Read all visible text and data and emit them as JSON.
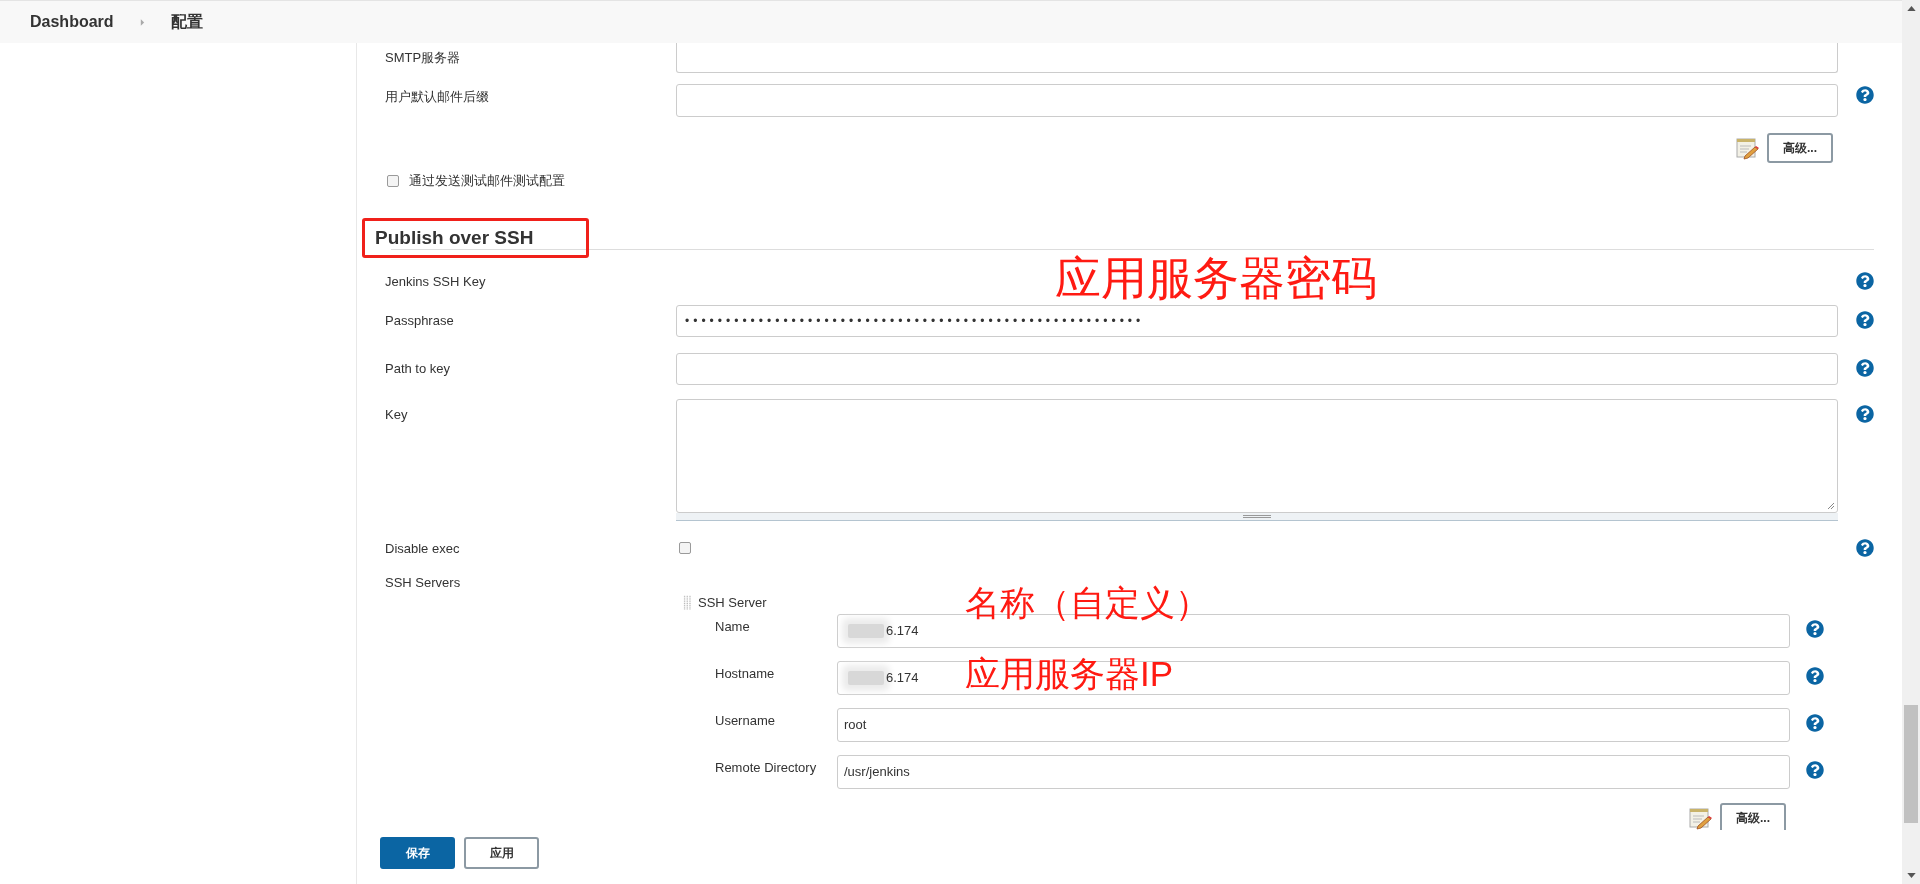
{
  "breadcrumb": [
    {
      "label": "Dashboard"
    },
    {
      "label": "配置"
    }
  ],
  "mail_fields": [
    {
      "label": "SMTP服务器",
      "help": false
    },
    {
      "label": "用户默认邮件后缀",
      "help": true
    }
  ],
  "mail_advanced_button": "高级...",
  "test_mail_checkbox": {
    "label": "通过发送测试邮件测试配置",
    "checked": false
  },
  "section_title": "Publish over SSH",
  "ssh_fields": [
    {
      "kind": "label",
      "label": "Jenkins SSH Key",
      "help": true
    },
    {
      "kind": "password",
      "label": "Passphrase",
      "value": "••••••••••••••••••••••••••••••••••••••••••••••••••••••••",
      "help": true
    },
    {
      "kind": "text",
      "label": "Path to key",
      "help": true
    },
    {
      "kind": "textarea",
      "label": "Key",
      "help": true
    },
    {
      "kind": "checkbox",
      "label": "Disable exec",
      "checked": false,
      "help": true
    }
  ],
  "ssh_servers": {
    "label": "SSH Servers",
    "server": {
      "title": "SSH Server",
      "fields": [
        {
          "label": "Name",
          "value": "6.174",
          "redacted": true,
          "help": true
        },
        {
          "label": "Hostname",
          "value": "6.174",
          "redacted": true,
          "help": true
        },
        {
          "label": "Username",
          "value": "root",
          "redacted": false,
          "help": true
        },
        {
          "label": "Remote Directory",
          "value": "/usr/jenkins",
          "redacted": false,
          "help": true
        }
      ],
      "advanced_button": "高级..."
    }
  },
  "annotations": [
    {
      "text": "应用服务器密码"
    },
    {
      "text": "名称（自定义）"
    },
    {
      "text": "应用服务器IP"
    }
  ],
  "buttons": [
    {
      "label": "保存",
      "kind": "primary"
    },
    {
      "label": "应用",
      "kind": "secondary"
    }
  ]
}
